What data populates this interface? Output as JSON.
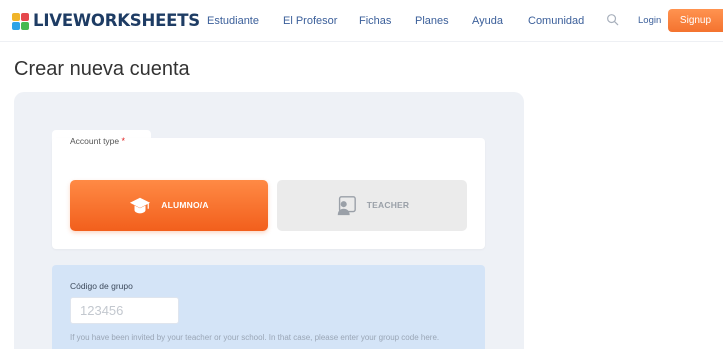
{
  "header": {
    "logo_text": "LIVEWORKSHEETS",
    "nav": [
      {
        "label": "Estudiante"
      },
      {
        "label": "El Profesor"
      },
      {
        "label": "Fichas"
      },
      {
        "label": "Planes"
      },
      {
        "label": "Ayuda"
      },
      {
        "label": "Comunidad"
      }
    ],
    "search_icon": "search-icon",
    "login_label": "Login",
    "signup_label": "Signup"
  },
  "page": {
    "title": "Crear nueva cuenta"
  },
  "form": {
    "account_type": {
      "label": "Account type",
      "required_mark": "*",
      "options": [
        {
          "label": "ALUMNO/A",
          "icon": "graduation-cap-icon",
          "selected": true
        },
        {
          "label": "TEACHER",
          "icon": "teacher-icon",
          "selected": false
        }
      ]
    },
    "group_code": {
      "label": "Código de grupo",
      "value": "",
      "placeholder": "123456",
      "help": "If you have been invited by your teacher or your school. In that case, please enter your group code here."
    }
  },
  "colors": {
    "accent": "#f4732f",
    "nav_link": "#3b5f9a",
    "logo": "#1e3c64",
    "panel_bg": "#eef1f6",
    "group_bg": "#d4e4f7"
  }
}
